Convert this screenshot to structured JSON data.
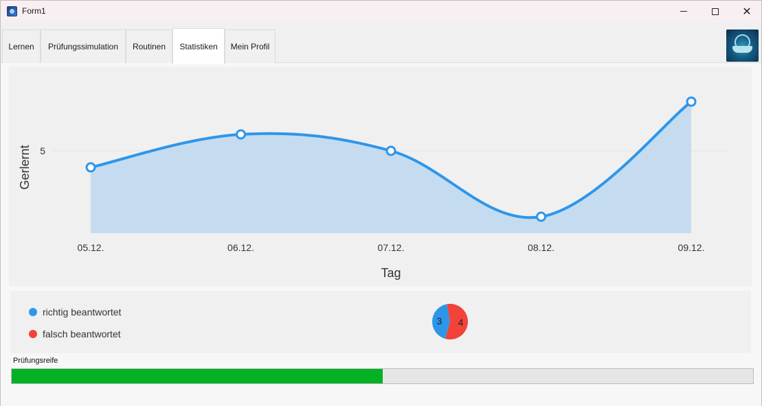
{
  "window": {
    "title": "Form1"
  },
  "tabs": [
    {
      "label": "Lernen",
      "active": false
    },
    {
      "label": "Prüfungssimulation",
      "active": false
    },
    {
      "label": "Routinen",
      "active": false
    },
    {
      "label": "Statistiken",
      "active": true
    },
    {
      "label": "Mein Profil",
      "active": false
    }
  ],
  "icons": {
    "app": "app-logo-icon",
    "minimize": "minimize-icon",
    "maximize": "maximize-icon",
    "close": "close-icon",
    "profile_logo": "book-globe-logo-icon"
  },
  "colors": {
    "series": "#2e96ea",
    "area": "#c5dcf0",
    "correct": "#2d96ea",
    "wrong": "#f2433a",
    "progress": "#06b025"
  },
  "chart_data": [
    {
      "type": "area",
      "categories": [
        "05.12.",
        "06.12.",
        "07.12.",
        "08.12.",
        "09.12."
      ],
      "series": [
        {
          "values": [
            4,
            6,
            5,
            1,
            7.99
          ]
        }
      ],
      "xlabel": "Tag",
      "ylabel": "Gerlernt",
      "yticks": [
        "5"
      ],
      "ylim": [
        0,
        8
      ],
      "grid": true,
      "smooth": true
    },
    {
      "type": "pie",
      "categories": [
        "richtig beantwortet",
        "falsch beantwortet"
      ],
      "values": [
        3,
        4
      ],
      "legend": "left"
    }
  ],
  "progress": {
    "label": "Prüfungsreife",
    "fraction": 0.5
  }
}
